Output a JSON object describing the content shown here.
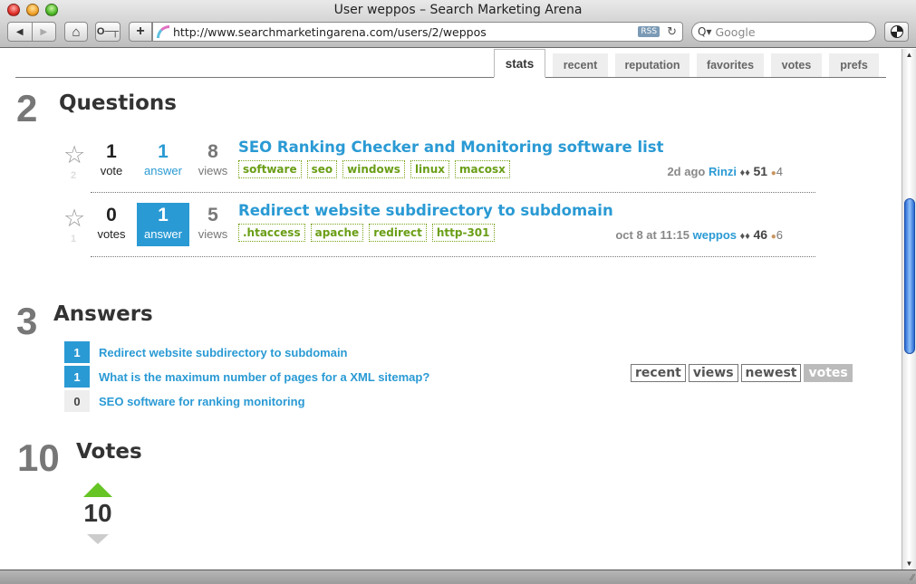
{
  "window": {
    "title": "User weppos – Search Marketing Arena"
  },
  "toolbar": {
    "back_icon": "◀",
    "forward_icon": "▶",
    "home_icon": "⌂",
    "key_icon": "⫘",
    "add_bookmark_icon": "+",
    "url": "http://www.searchmarketingarena.com/users/2/weppos",
    "rss_label": "RSS",
    "reload_icon": "↻",
    "search_placeholder": "Google",
    "search_icon": "Q▾"
  },
  "tabs": [
    {
      "label": "stats",
      "active": true
    },
    {
      "label": "recent"
    },
    {
      "label": "reputation"
    },
    {
      "label": "favorites"
    },
    {
      "label": "votes"
    },
    {
      "label": "prefs"
    }
  ],
  "questions": {
    "count": "2",
    "title": "Questions",
    "items": [
      {
        "favorites": "2",
        "votes": "1",
        "votes_label": "vote",
        "answers": "1",
        "answers_label": "answer",
        "accepted": false,
        "views": "8",
        "views_label": "views",
        "title": "SEO Ranking Checker and Monitoring software list",
        "tags": [
          "software",
          "seo",
          "windows",
          "linux",
          "macosx"
        ],
        "time": "2d ago",
        "user": "Rinzi",
        "diamonds": "♦♦",
        "rep": "51",
        "badge_dot": "●",
        "badges": "4"
      },
      {
        "favorites": "1",
        "votes": "0",
        "votes_label": "votes",
        "answers": "1",
        "answers_label": "answer",
        "accepted": true,
        "views": "5",
        "views_label": "views",
        "title": "Redirect website subdirectory to subdomain",
        "tags": [
          ".htaccess",
          "apache",
          "redirect",
          "http-301"
        ],
        "time": "oct 8 at 11:15",
        "user": "weppos",
        "diamonds": "♦♦",
        "rep": "46",
        "badge_dot": "●",
        "badges": "6"
      }
    ]
  },
  "answers": {
    "count": "3",
    "title": "Answers",
    "sort": [
      "recent",
      "views",
      "newest",
      "votes"
    ],
    "sort_active": "votes",
    "items": [
      {
        "score": "1",
        "title": "Redirect website subdirectory to subdomain"
      },
      {
        "score": "1",
        "title": "What is the maximum number of pages for a XML sitemap?"
      },
      {
        "score": "0",
        "title": "SEO software for ranking monitoring"
      }
    ]
  },
  "votes": {
    "count": "10",
    "title": "Votes",
    "up": "10"
  },
  "colors": {
    "accent": "#2a9ad4",
    "tag_green": "#6a9e16",
    "upvote": "#66c424",
    "downvote": "#cccccc"
  }
}
